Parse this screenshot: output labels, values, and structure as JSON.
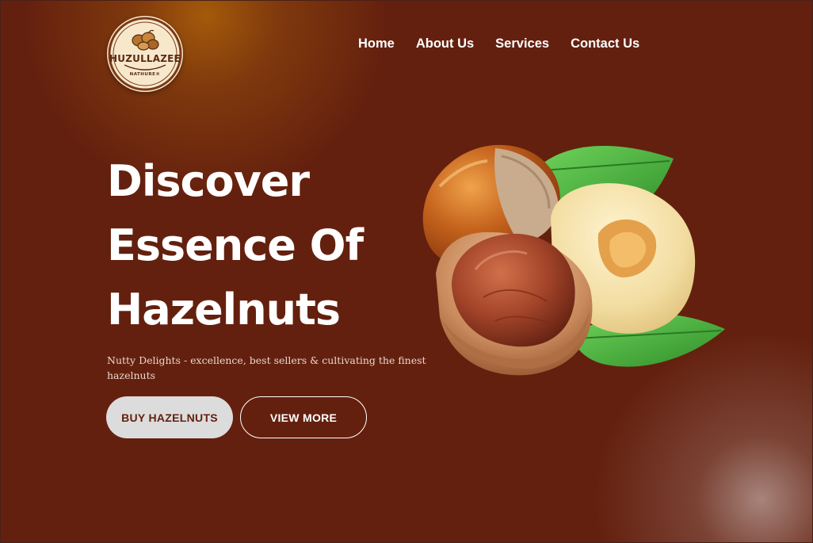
{
  "brand": {
    "name": "HUZULLAZEE",
    "sub": "NATHURE®"
  },
  "nav": {
    "items": [
      {
        "label": "Home"
      },
      {
        "label": "About Us"
      },
      {
        "label": "Services"
      },
      {
        "label": "Contact Us"
      }
    ]
  },
  "hero": {
    "title_lines": [
      "Discover",
      "Essence Of",
      "Hazelnuts"
    ],
    "tagline": "Nutty Delights - excellence, best sellers & cultivating the finest hazelnuts",
    "buttons": {
      "buy_label": "BUY HAZELNUTS",
      "more_label": "VIEW MORE"
    }
  },
  "colors": {
    "background": "#64200e",
    "accent_glow": "#af640a",
    "button_light": "#dcdcdc",
    "text": "#ffffff"
  },
  "icons": [
    "hazelnut-logo-icon",
    "hazelnuts-hero-image"
  ]
}
